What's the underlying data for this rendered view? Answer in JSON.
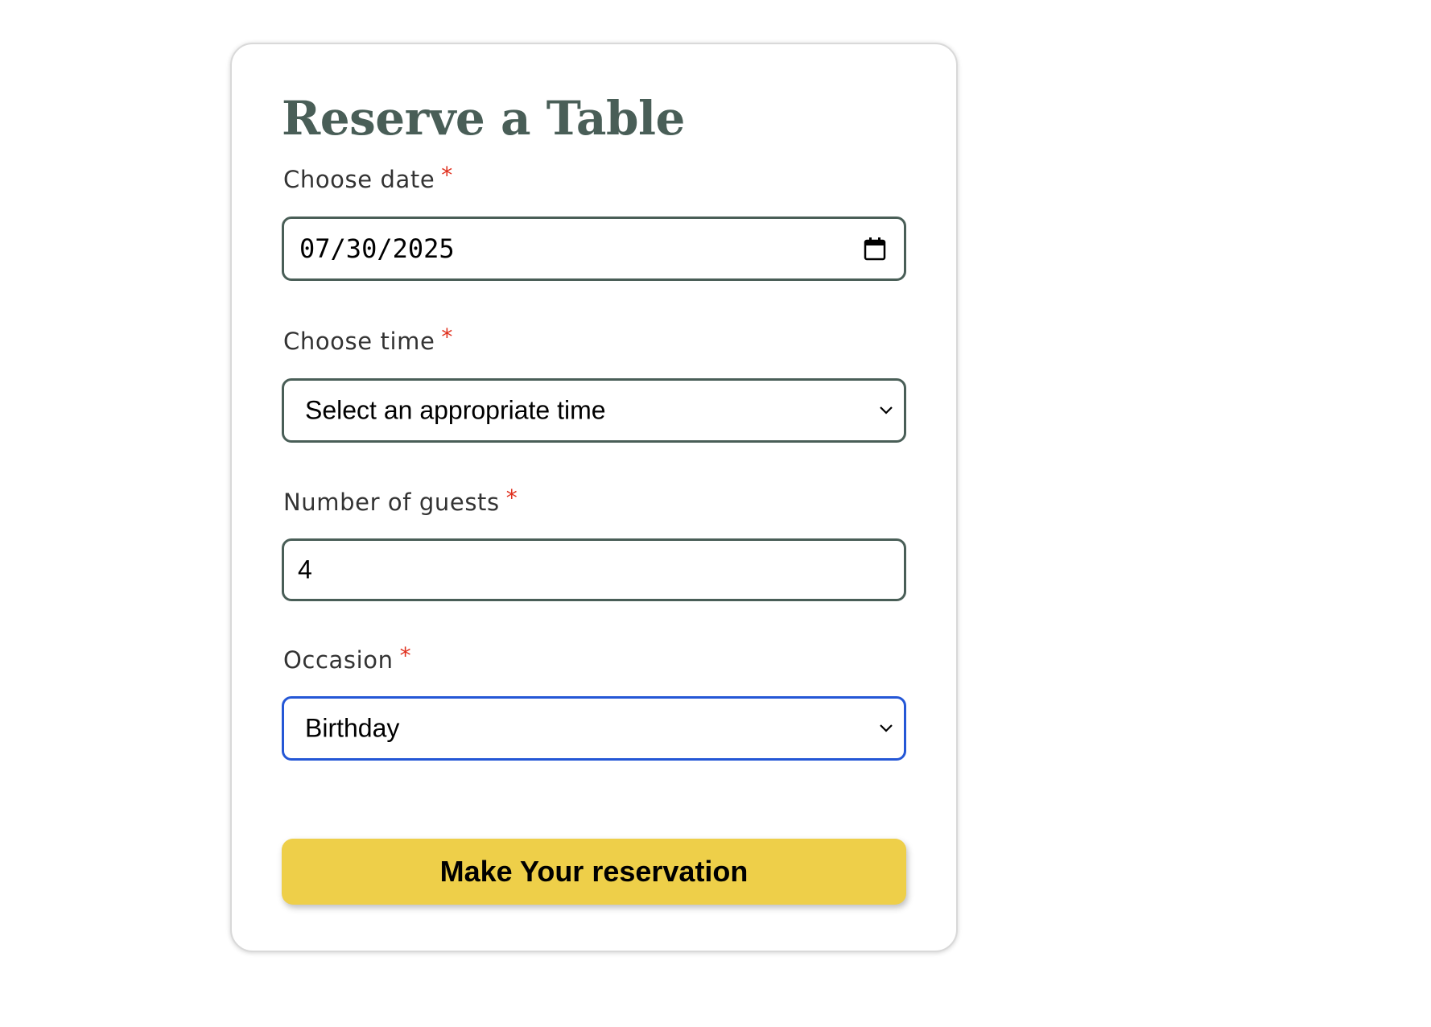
{
  "form": {
    "title": "Reserve a Table",
    "required_marker": "*",
    "date": {
      "label": "Choose date",
      "value": "07/30/2025",
      "icon": "calendar-icon"
    },
    "time": {
      "label": "Choose time",
      "selected": "Select an appropriate time",
      "icon": "chevron-down-icon"
    },
    "guests": {
      "label": "Number of guests",
      "value": "4"
    },
    "occasion": {
      "label": "Occasion",
      "selected": "Birthday",
      "icon": "chevron-down-icon",
      "focused": true
    },
    "submit_label": "Make Your reservation"
  },
  "colors": {
    "title": "#495e57",
    "field_border": "#495e57",
    "focus_border": "#2457d6",
    "required": "#e0301e",
    "button_bg": "#eecf49"
  }
}
